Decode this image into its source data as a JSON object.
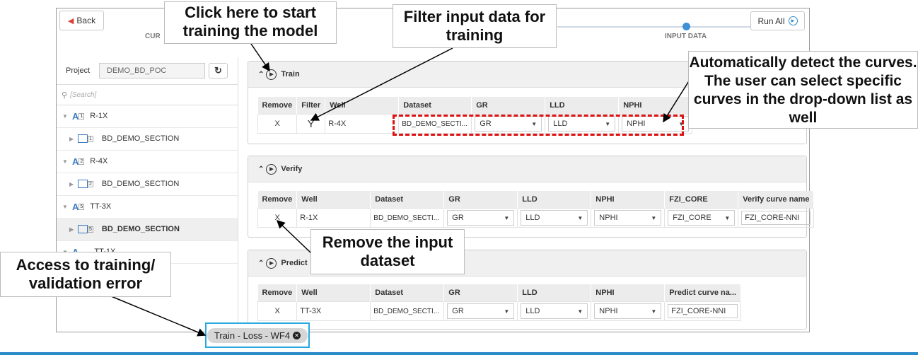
{
  "toolbar": {
    "back_label": "Back",
    "run_all_label": "Run All"
  },
  "stepper": {
    "left_label": "CUR",
    "right_label": "INPUT DATA"
  },
  "project": {
    "label": "Project",
    "value": "DEMO_BD_POC"
  },
  "search": {
    "placeholder": "[Search]"
  },
  "tree": {
    "items": [
      {
        "label": "R-1X",
        "badge": "1",
        "type": "well"
      },
      {
        "label": "BD_DEMO_SECTION",
        "badge": "1",
        "type": "dataset"
      },
      {
        "label": "R-4X",
        "badge": "2",
        "type": "well"
      },
      {
        "label": "BD_DEMO_SECTION",
        "badge": "2",
        "type": "dataset"
      },
      {
        "label": "TT-3X",
        "badge": "5",
        "type": "well"
      },
      {
        "label": "BD_DEMO_SECTION",
        "badge": "5",
        "type": "dataset"
      },
      {
        "label": "TT-1X",
        "badge": "",
        "type": "well"
      }
    ]
  },
  "train": {
    "title": "Train",
    "headers": [
      "Remove",
      "Filter",
      "Well",
      "Dataset",
      "GR",
      "LLD",
      "NPHI"
    ],
    "row": {
      "remove": "X",
      "filter": "Y",
      "well": "R-4X",
      "dataset": "BD_DEMO_SECTI...",
      "gr": "GR",
      "lld": "LLD",
      "nphi": "NPHI"
    }
  },
  "verify": {
    "title": "Verify",
    "headers": [
      "Remove",
      "Well",
      "Dataset",
      "GR",
      "LLD",
      "NPHI",
      "FZI_CORE",
      "Verify curve name"
    ],
    "row": {
      "remove": "X",
      "well": "R-1X",
      "dataset": "BD_DEMO_SECTI...",
      "gr": "GR",
      "lld": "LLD",
      "nphi": "NPHI",
      "fzi": "FZI_CORE",
      "curve": "FZI_CORE-NNI"
    }
  },
  "predict": {
    "title": "Predict",
    "headers": [
      "Remove",
      "Well",
      "Dataset",
      "GR",
      "LLD",
      "NPHI",
      "Predict curve na..."
    ],
    "row": {
      "remove": "X",
      "well": "TT-3X",
      "dataset": "BD_DEMO_SECTI...",
      "gr": "GR",
      "lld": "LLD",
      "nphi": "NPHI",
      "curve": "FZI_CORE-NNI"
    }
  },
  "bottom_tab": {
    "label": "Train - Loss - WF4"
  },
  "callouts": {
    "start_training": "Click here to start training the model",
    "filter_input": "Filter input data for training",
    "auto_detect": "Automatically detect the curves. The user can select specific curves in the drop-down list as well",
    "remove_dataset": "Remove the input dataset",
    "access_error": "Access to training/ validation error"
  },
  "colors": {
    "accent": "#3d8fd6",
    "highlight": "#e01010",
    "tab_border": "#29a8e0"
  }
}
